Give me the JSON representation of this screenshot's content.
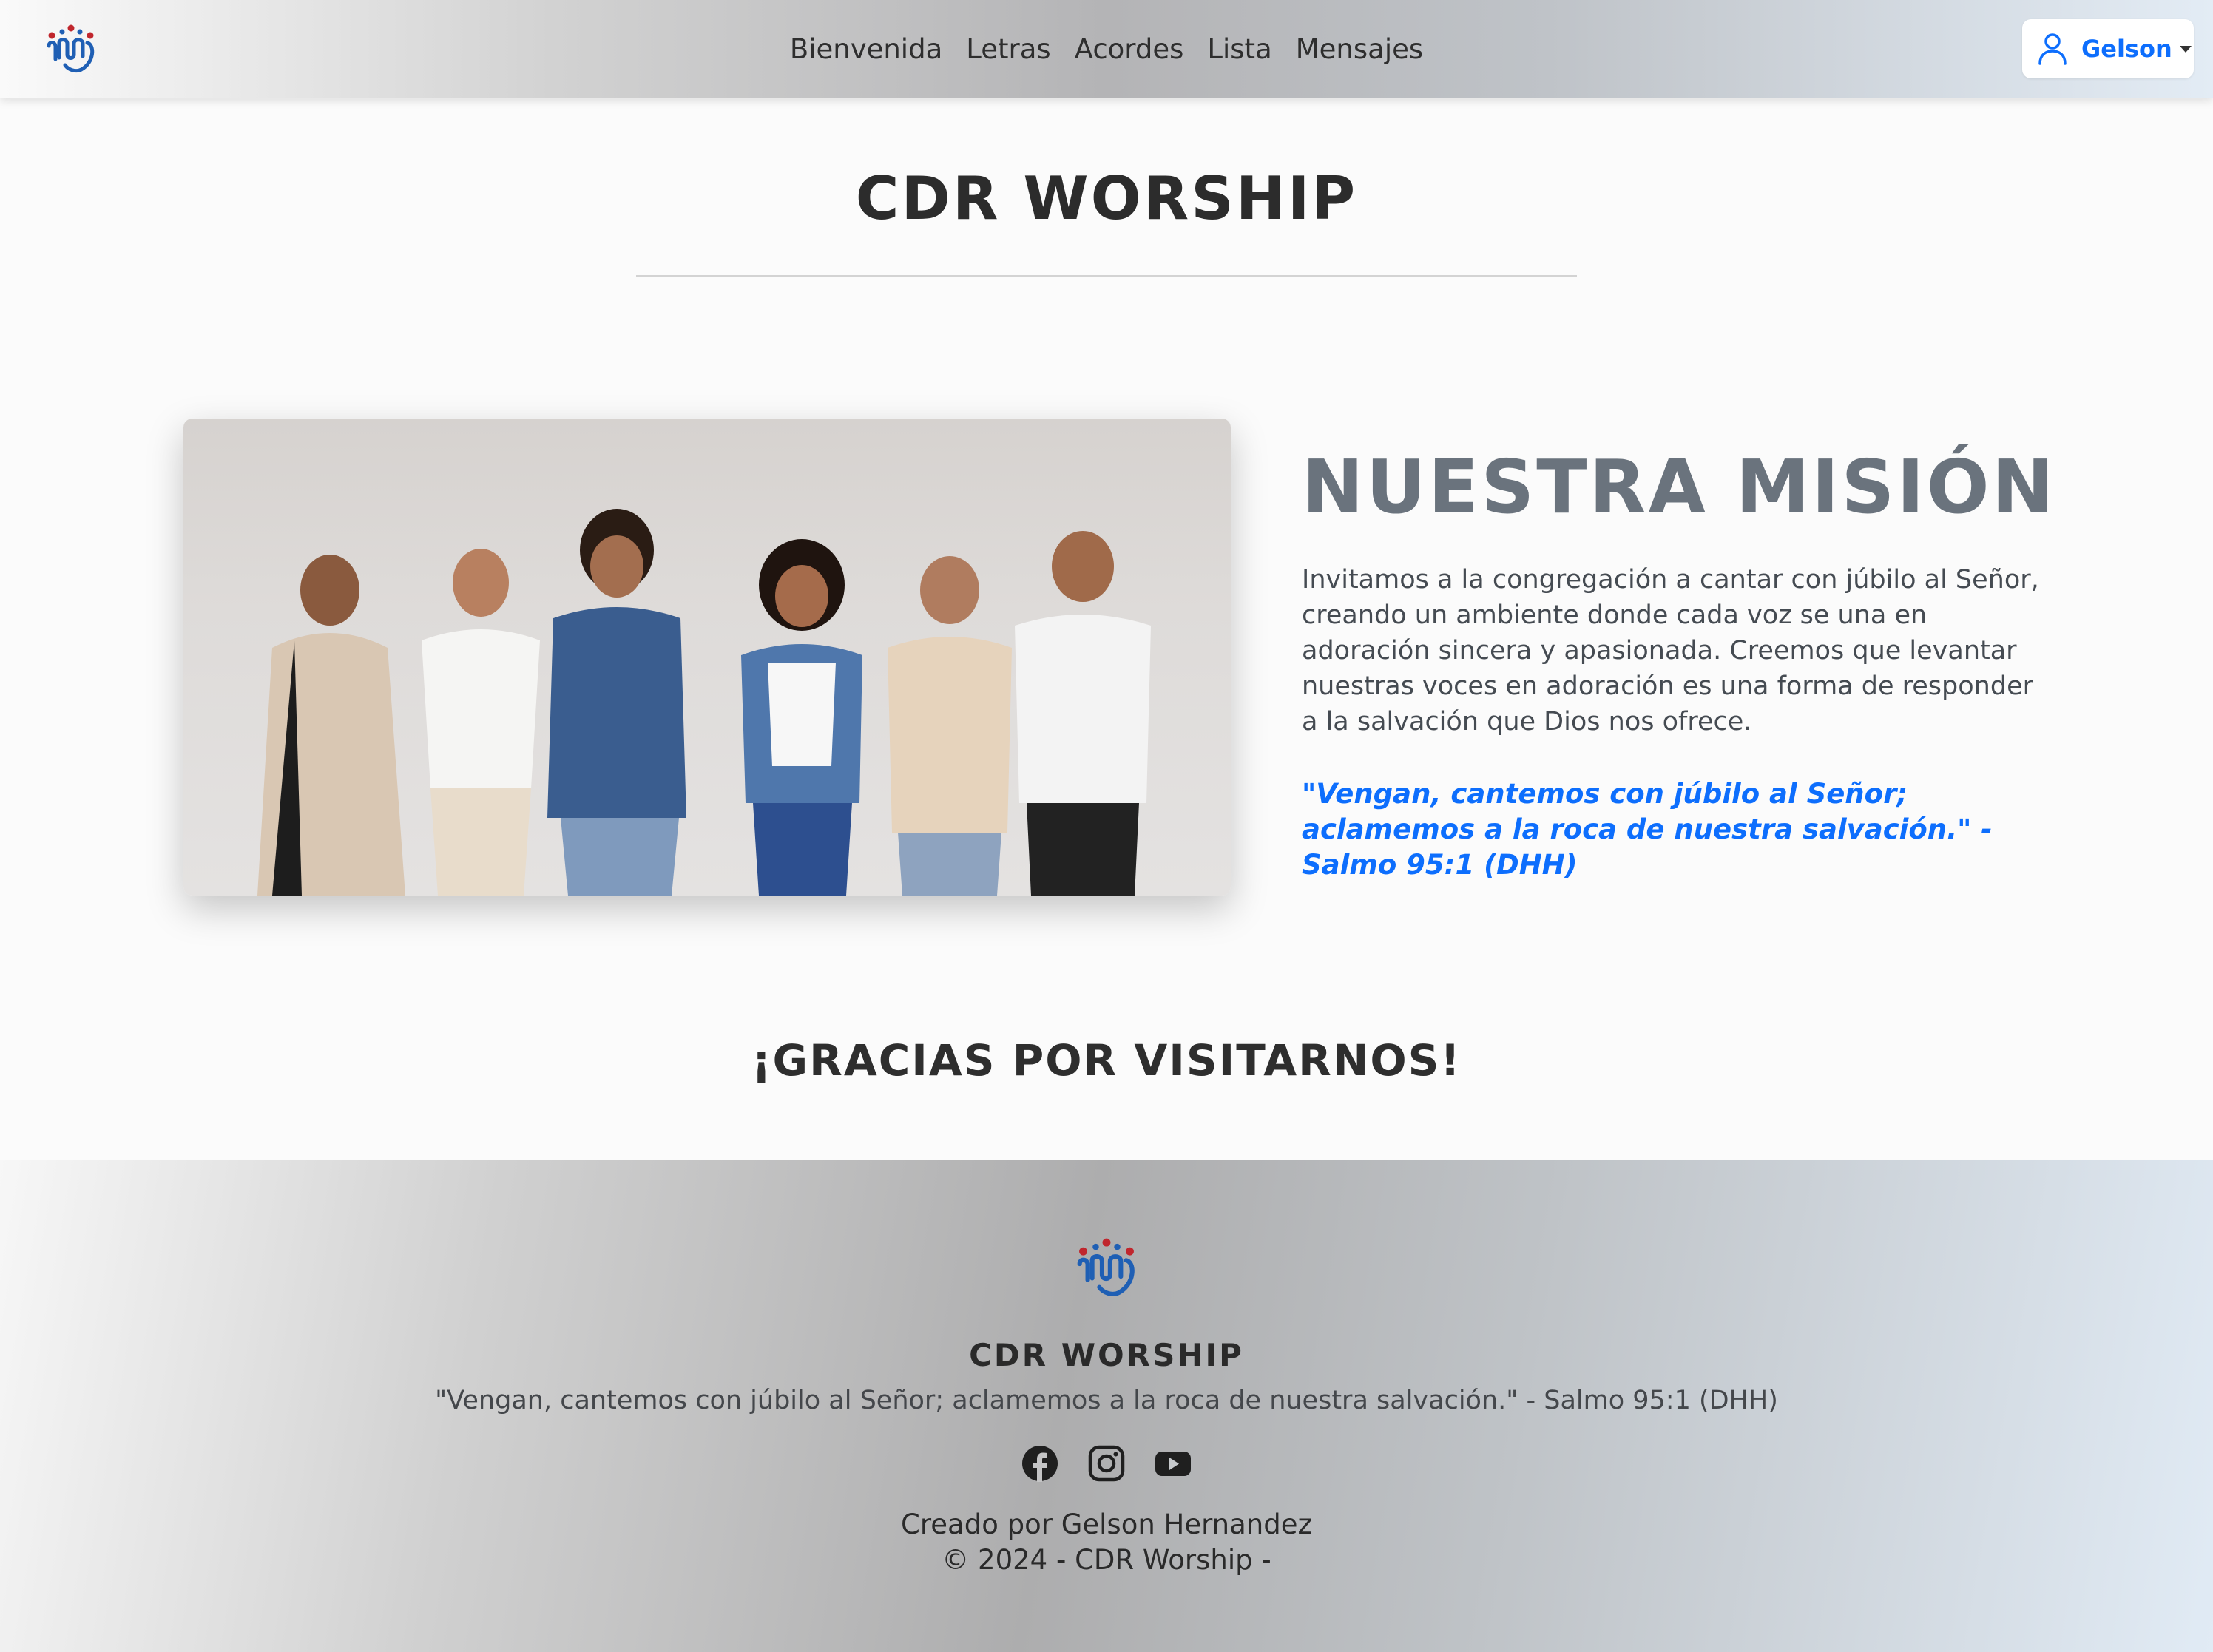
{
  "navbar": {
    "logo_icon": "ministry-logo-icon",
    "links": [
      "Bienvenida",
      "Letras",
      "Acordes",
      "Lista",
      "Mensajes"
    ],
    "user": {
      "icon": "user-icon",
      "name": "Gelson"
    }
  },
  "main": {
    "title": "CDR WORSHIP",
    "mission": {
      "heading": "NUESTRA MISIÓN",
      "text": "Invitamos a la congregación a cantar con júbilo al Señor, creando un ambiente donde cada voz se una en adoración sincera y apasionada. Creemos que levantar nuestras voces en adoración es una forma de responder a la salvación que Dios nos ofrece.",
      "verse": "\"Vengan, cantemos con júbilo al Señor; aclamemos a la roca de nuestra salvación.\" - Salmo 95:1 (DHH)"
    },
    "thanks": "¡GRACIAS POR VISITARNOS!"
  },
  "footer": {
    "title": "CDR WORSHIP",
    "verse": "\"Vengan, cantemos con júbilo al Señor; aclamemos a la roca de nuestra salvación.\" - Salmo 95:1 (DHH)",
    "social": [
      "facebook-icon",
      "instagram-icon",
      "youtube-icon"
    ],
    "credit": "Creado por Gelson Hernandez",
    "copyright": "© 2024 - CDR Worship -"
  },
  "colors": {
    "accent": "#0d6efd",
    "heading_gray": "#6a737d",
    "logo_blue": "#1f5fb4",
    "logo_red": "#c0262d"
  }
}
